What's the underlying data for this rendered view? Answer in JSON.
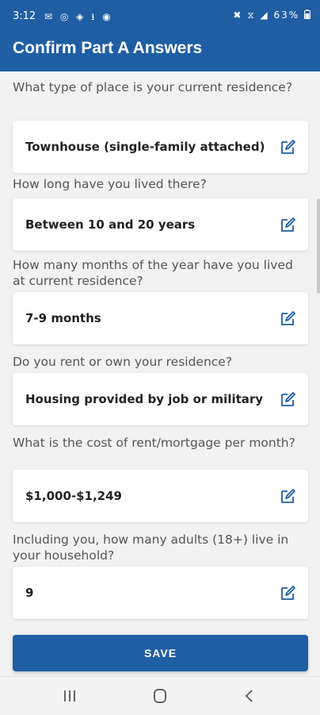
{
  "status_bar": {
    "time": "3:12",
    "left_icons": [
      "notification-icon",
      "whatsapp-icon",
      "shield-icon",
      "download-icon",
      "location-icon"
    ],
    "left_icons_display": "✉ ◎ ◈ ⭳ ◉",
    "right_icons": [
      "mute-icon",
      "alarm-icon",
      "wifi-icon",
      "signal-icon"
    ],
    "right_icons_display": "✖ ⧖ ◢",
    "battery": "63%"
  },
  "app_bar": {
    "title": "Confirm Part A Answers"
  },
  "questions": [
    {
      "question": "What type of place is your current residence?",
      "answer": "Townhouse (single-family attached)"
    },
    {
      "question": "How long have you lived there?",
      "answer": "Between 10 and 20 years"
    },
    {
      "question": "How many months of the year have you lived at current residence?",
      "answer": "7-9 months"
    },
    {
      "question": "Do you rent or own your residence?",
      "answer": "Housing provided by job or military"
    },
    {
      "question": "What is the cost of rent/mortgage per month?",
      "answer": "$1,000-$1,249"
    },
    {
      "question": "Including you, how many adults (18+) live in your household?",
      "answer": "9"
    }
  ],
  "save_label": "SAVE",
  "colors": {
    "primary": "#1f5ea3",
    "background": "#f2f2f2",
    "card": "#ffffff",
    "question_text": "#555555",
    "answer_text": "#222222"
  },
  "nav_bar": {
    "buttons": [
      "recent-apps-icon",
      "home-icon",
      "back-icon"
    ]
  }
}
